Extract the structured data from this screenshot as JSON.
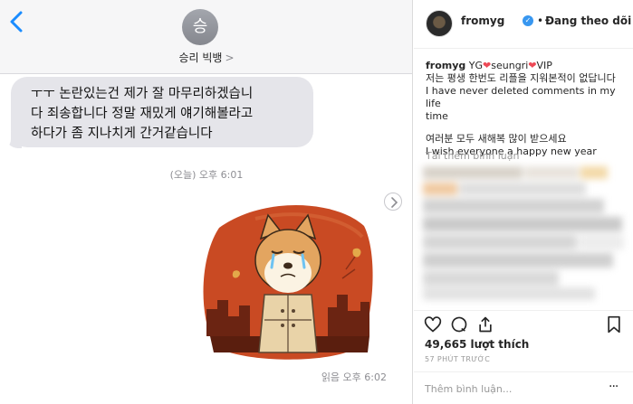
{
  "imessage": {
    "avatar_initial": "승",
    "contact_name": "승리 빅뱅",
    "contact_chevron": ">",
    "message_lines": [
      "ㅜㅜ 논란있는건 제가 잘 마무리하겠습니",
      "다 죄송합니다 정말 재밌게 얘기해볼라고",
      "하다가 좀 지나치게 간거같습니다"
    ],
    "timestamp": "(오늘) 오후 6:01",
    "read_receipt": "읽음 오후 6:02",
    "colors": {
      "bubble": "#e5e5ea",
      "back_arrow": "#1a8cff",
      "sticker_bg": "#c94a23"
    }
  },
  "instagram": {
    "username": "fromyg",
    "follow_label": "Đang theo dõi",
    "caption": {
      "user": "fromyg",
      "text_before": "YG",
      "mention": "seungri",
      "text_after": "VIP",
      "lines": [
        "저는 평생 한번도 리플을 지워본적이 없답니다",
        "I have never deleted comments in my life",
        "time"
      ],
      "lines2": [
        "여러분 모두 새해복 많이 받으세요",
        "I wish everyone a happy new year"
      ]
    },
    "load_more_comments": "Tải thêm bình luận",
    "likes": "49,665 lượt thích",
    "time_ago": "57 PHÚT TRƯỚC",
    "comment_placeholder": "Thêm bình luận...",
    "more_options": "···",
    "icons": [
      "heart-icon",
      "comment-icon",
      "share-icon",
      "bookmark-icon"
    ],
    "colors": {
      "verified": "#3897f0",
      "heart": "#ed4956"
    }
  }
}
